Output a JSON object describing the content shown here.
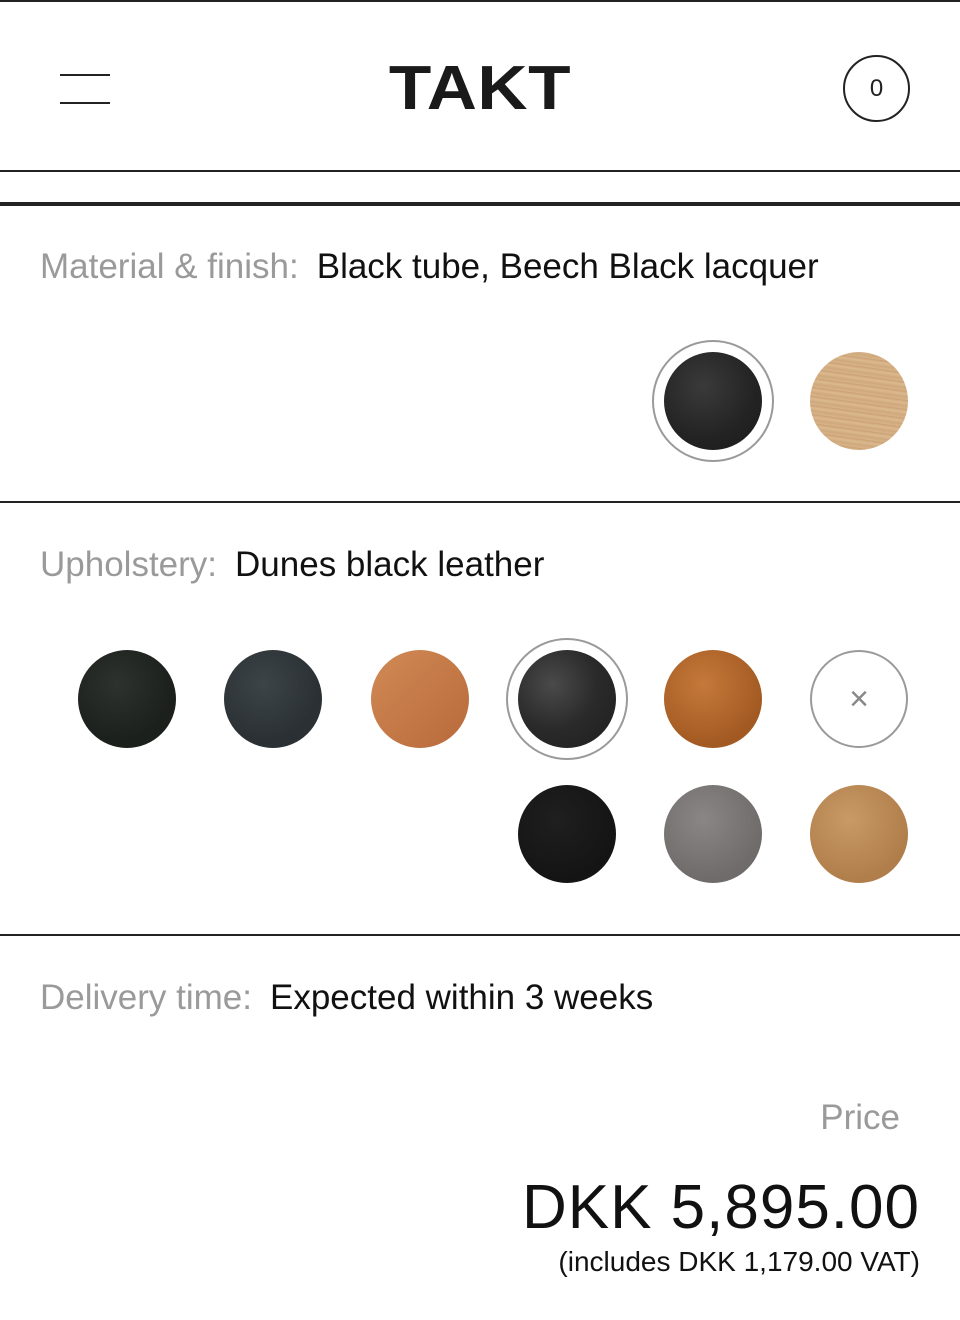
{
  "header": {
    "logo": "TAKT",
    "cart_count": "0"
  },
  "material": {
    "label": "Material & finish:",
    "value": "Black tube, Beech Black lacquer",
    "swatches": [
      {
        "name": "black-tube-beech-black",
        "color": "#232323",
        "selected": true
      },
      {
        "name": "oak",
        "color": "#d4ad80",
        "selected": false
      }
    ]
  },
  "upholstery": {
    "label": "Upholstery:",
    "value": "Dunes black leather",
    "swatches": [
      {
        "color": "#1c201c",
        "selected": false
      },
      {
        "color": "#2a3033",
        "selected": false
      },
      {
        "color": "#c57a46",
        "selected": false
      },
      {
        "color": "#2a2a2a",
        "selected": true
      },
      {
        "color": "#a35a22",
        "selected": false
      },
      {
        "icon": "close-icon",
        "selected": false
      },
      {
        "color": "#141414",
        "selected": false
      },
      {
        "color": "#6f6b6b",
        "selected": false
      },
      {
        "color": "#b07e4a",
        "selected": false
      }
    ],
    "none_symbol": "×"
  },
  "delivery": {
    "label": "Delivery time:",
    "value": "Expected within 3 weeks"
  },
  "price": {
    "label": "Price",
    "value": "DKK 5,895.00",
    "vat_note": "(includes DKK 1,179.00 VAT)"
  }
}
